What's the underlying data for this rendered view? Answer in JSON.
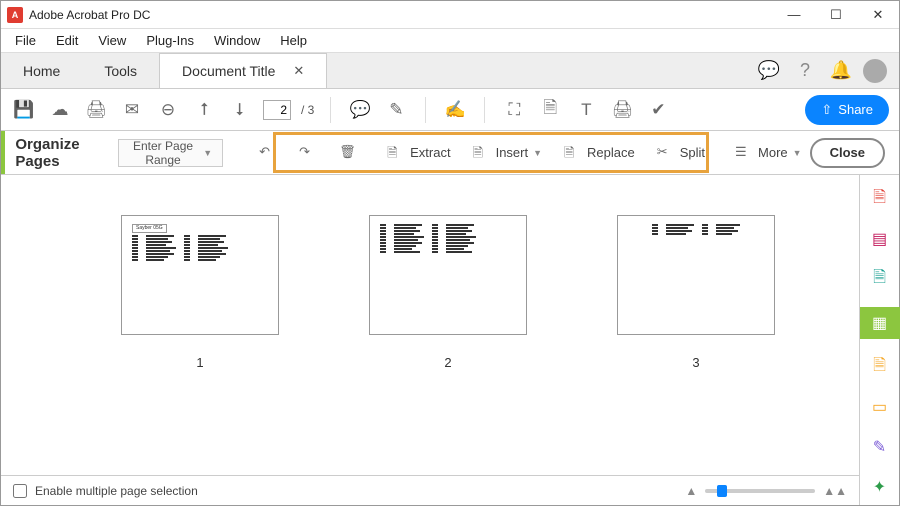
{
  "window": {
    "app_title": "Adobe Acrobat Pro DC",
    "minimize": "—",
    "maximize": "☐",
    "close": "✕"
  },
  "menu": [
    "File",
    "Edit",
    "View",
    "Plug-Ins",
    "Window",
    "Help"
  ],
  "tabs": {
    "home": "Home",
    "tools": "Tools",
    "doc": "Document Title",
    "close": "✕"
  },
  "topright_icons": [
    "chat-icon",
    "help-icon",
    "bell-icon",
    "profile-icon"
  ],
  "toolbar_main": {
    "page_current": "2",
    "page_total": "/ 3",
    "share": "Share"
  },
  "organize": {
    "title": "Organize Pages",
    "range_label": "Enter Page Range",
    "extract": "Extract",
    "insert": "Insert",
    "replace": "Replace",
    "split": "Split",
    "more": "More",
    "close": "Close"
  },
  "pages": [
    {
      "label": "1",
      "badge": "Sayber 05G"
    },
    {
      "label": "2",
      "badge": ""
    },
    {
      "label": "3",
      "badge": ""
    }
  ],
  "footer": {
    "checkbox_label": "Enable multiple page selection"
  },
  "rightrail": [
    "page-red-icon",
    "layout-icon",
    "export-icon",
    "organize-icon",
    "note-icon",
    "comment-icon",
    "sign-icon",
    "stamp-icon"
  ]
}
